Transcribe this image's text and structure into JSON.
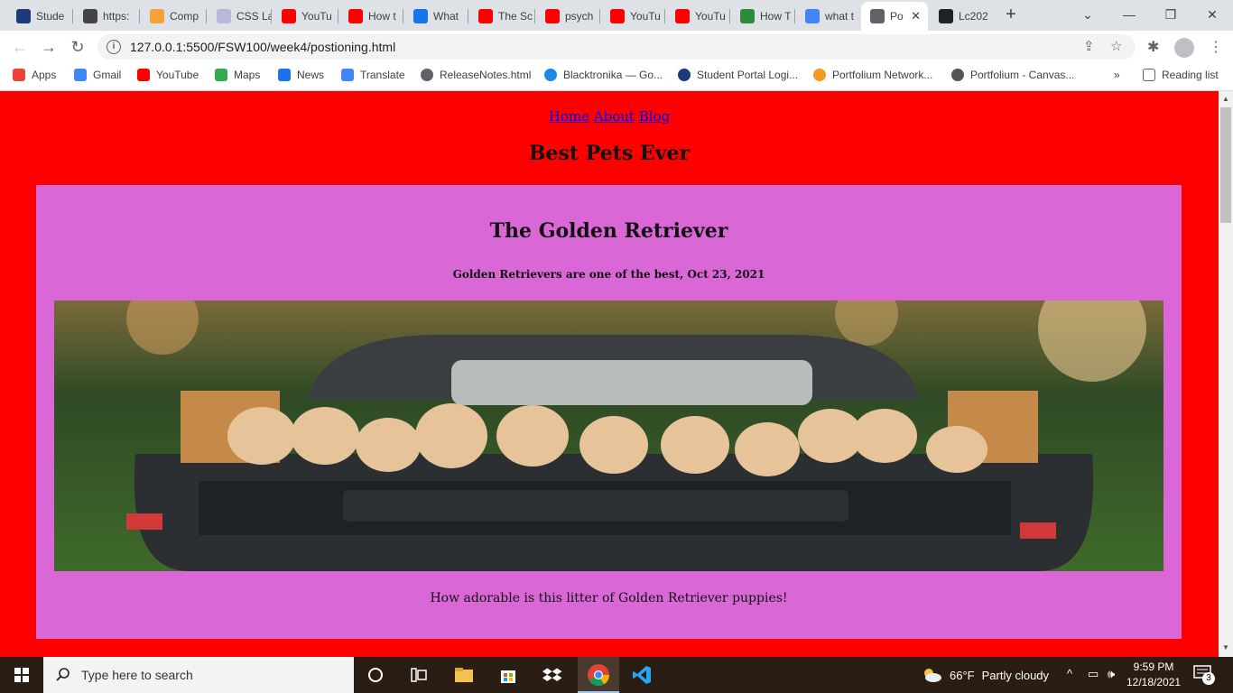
{
  "browser": {
    "tabs": [
      {
        "label": "Stude",
        "icon": "student-portal-icon",
        "color": "#1a3a7a"
      },
      {
        "label": "https:",
        "icon": "page-icon",
        "color": "#444444"
      },
      {
        "label": "Comp",
        "icon": "comp-icon",
        "color": "#f2a33a"
      },
      {
        "label": "CSS La",
        "icon": "css-icon",
        "color": "#b8b8d8"
      },
      {
        "label": "YouTu",
        "icon": "youtube-icon",
        "color": "#ff0000"
      },
      {
        "label": "How t",
        "icon": "youtube-icon",
        "color": "#ff0000"
      },
      {
        "label": "What",
        "icon": "c-icon",
        "color": "#1a73e8"
      },
      {
        "label": "The Sc",
        "icon": "youtube-icon",
        "color": "#ff0000"
      },
      {
        "label": "psych",
        "icon": "youtube-icon",
        "color": "#ff0000"
      },
      {
        "label": "YouTu",
        "icon": "youtube-icon",
        "color": "#ff0000"
      },
      {
        "label": "YouTu",
        "icon": "youtube-icon",
        "color": "#ff0000"
      },
      {
        "label": "How T",
        "icon": "wikihow-icon",
        "color": "#2e8b3a"
      },
      {
        "label": "what t",
        "icon": "google-icon",
        "color": "#4285f4"
      },
      {
        "label": "Po",
        "icon": "globe-icon",
        "color": "#5f6368",
        "active": true
      },
      {
        "label": "Lc202",
        "icon": "github-icon",
        "color": "#202124"
      }
    ],
    "url": "127.0.0.1:5500/FSW100/week4/postioning.html",
    "bookmarks": [
      {
        "label": "Apps",
        "icon": "apps-grid-icon",
        "color": "#ea4335"
      },
      {
        "label": "Gmail",
        "icon": "google-icon",
        "color": "#4285f4"
      },
      {
        "label": "YouTube",
        "icon": "youtube-icon",
        "color": "#ff0000"
      },
      {
        "label": "Maps",
        "icon": "maps-icon",
        "color": "#34a853"
      },
      {
        "label": "News",
        "icon": "news-icon",
        "color": "#1a73e8"
      },
      {
        "label": "Translate",
        "icon": "translate-icon",
        "color": "#4285f4"
      },
      {
        "label": "ReleaseNotes.html",
        "icon": "globe-icon",
        "color": "#5f6368"
      },
      {
        "label": "Blacktronika — Go...",
        "icon": "blacktronika-icon",
        "color": "#1e88e5"
      },
      {
        "label": "Student Portal Logi...",
        "icon": "student-portal-icon",
        "color": "#1a3a7a"
      },
      {
        "label": "Portfolium Network...",
        "icon": "portfolium-icon",
        "color": "#f29a1f"
      },
      {
        "label": "Portfolium - Canvas...",
        "icon": "canvas-icon",
        "color": "#555555"
      }
    ],
    "reading_list": "Reading list"
  },
  "page": {
    "nav": [
      "Home",
      "About",
      "Blog"
    ],
    "title": "Best Pets Ever",
    "article": {
      "heading": "The Golden Retriever",
      "byline": "Golden Retrievers are one of the best, Oct 23, 2021",
      "caption": "How adorable is this litter of Golden Retriever puppies!"
    },
    "background": "#ff0000",
    "card_color": "#da67d6"
  },
  "taskbar": {
    "search_placeholder": "Type here to search",
    "weather": {
      "temp": "66°F",
      "condition": "Partly cloudy"
    },
    "time": "9:59 PM",
    "date": "12/18/2021",
    "notifications": "3"
  }
}
